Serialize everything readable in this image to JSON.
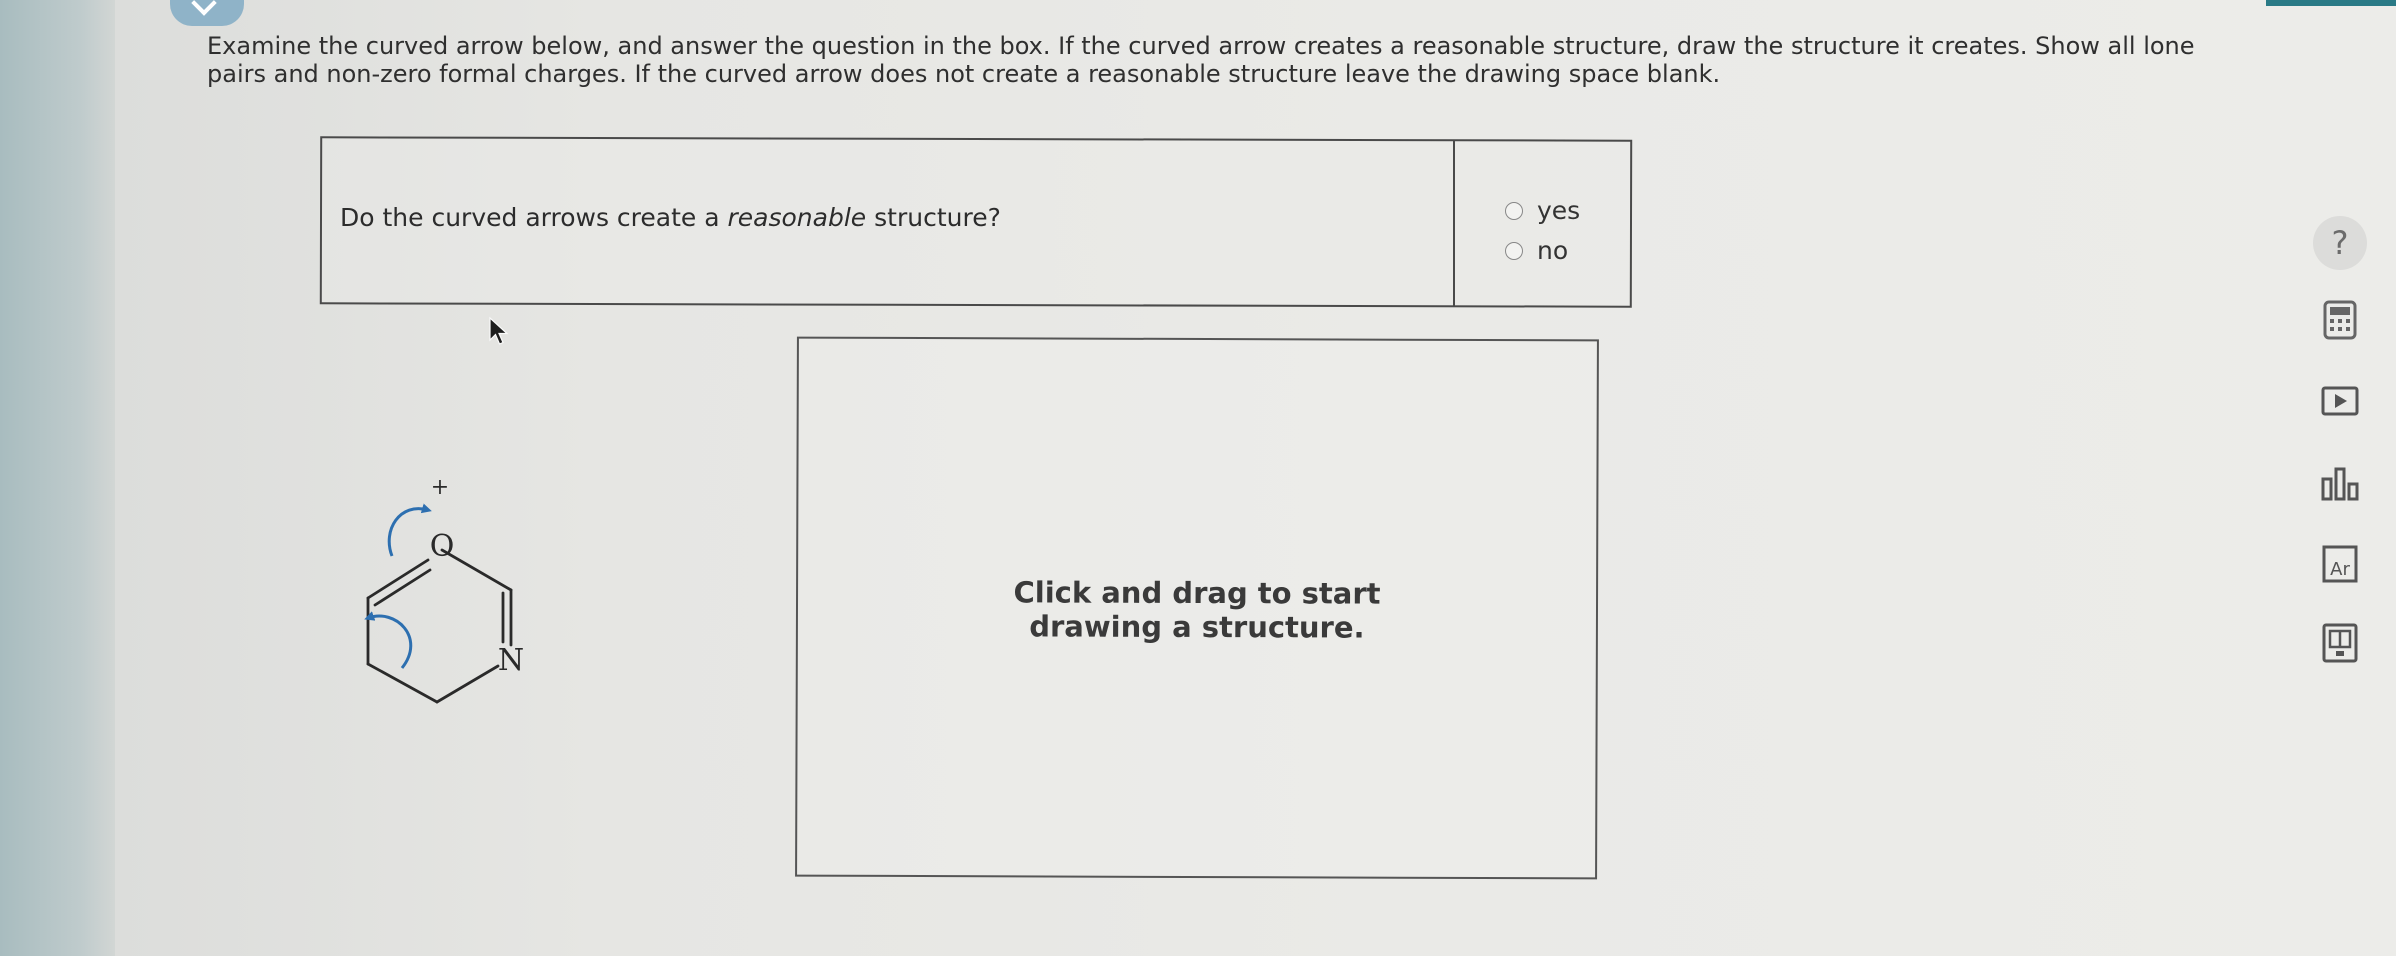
{
  "instructions": {
    "text": "Examine the curved arrow below, and answer the question in the box. If the curved arrow creates a reasonable structure, draw the structure it creates. Show all lone pairs and non-zero formal charges. If the curved arrow does not create a reasonable structure leave the drawing space blank."
  },
  "question": {
    "prefix": "Do the curved arrows create a ",
    "emphasis": "reasonable",
    "suffix": " structure?",
    "options": [
      {
        "label": "yes"
      },
      {
        "label": "no"
      }
    ]
  },
  "molecule": {
    "charge": "+",
    "atoms": {
      "oxygen": "O",
      "nitrogen": "N"
    },
    "arrow_color": "#2d6fb0"
  },
  "drawing": {
    "hint_line1": "Click and drag to start",
    "hint_line2": "drawing a structure."
  },
  "sidebar": {
    "help": "?",
    "tools": [
      {
        "icon": "calculator-icon"
      },
      {
        "icon": "video-icon"
      },
      {
        "icon": "bar-chart-icon"
      },
      {
        "icon": "periodic-table-icon",
        "text": "Ar"
      },
      {
        "icon": "textbook-icon"
      }
    ]
  }
}
